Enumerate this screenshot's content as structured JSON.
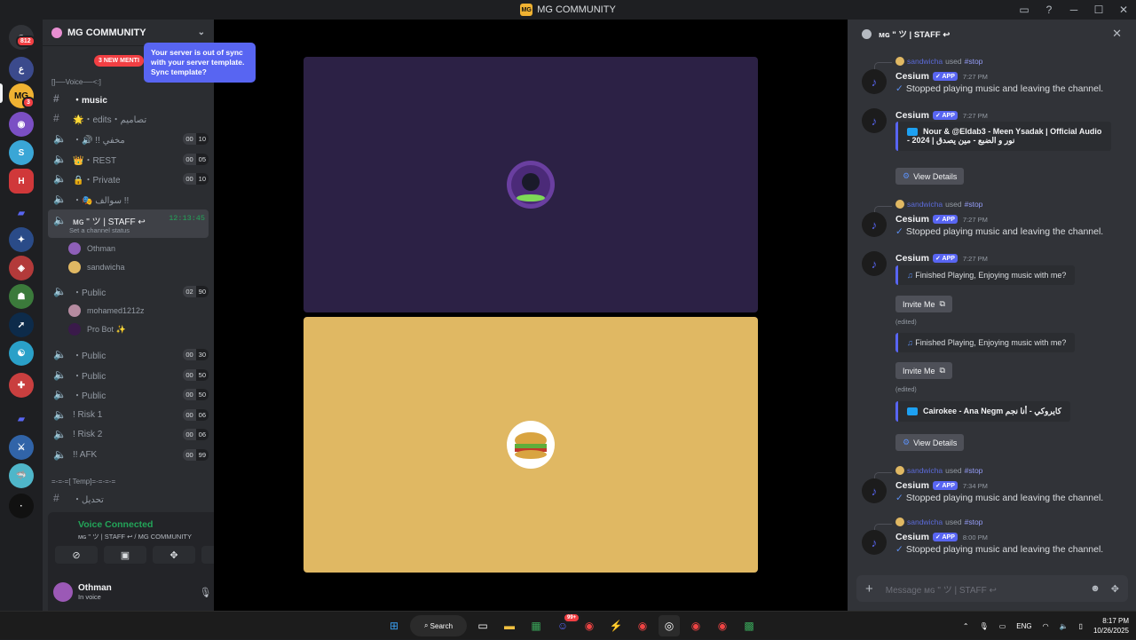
{
  "window": {
    "title": "MG COMMUNITY",
    "logo_text": "MG"
  },
  "rail": {
    "badge_top": "812",
    "badge_mg": "3"
  },
  "guild": {
    "name": "MG COMMUNITY",
    "tooltip": "Your server is out of sync with your server template. Sync template?",
    "new_mentions": "3 NEW MENTI"
  },
  "categories": {
    "voice": "[]──Voice──<:]",
    "temp": "=-=-=[ Temp]=-=-=-="
  },
  "channels": [
    {
      "name": "・music",
      "icon": "#",
      "counts": null
    },
    {
      "name": "🌟・edits・تصاميم",
      "icon": "#",
      "counts": null
    },
    {
      "name": "・🔊 !! مخفي",
      "icon": "🔊",
      "counts": [
        "00",
        "10"
      ]
    },
    {
      "name": "👑・REST",
      "icon": "🔊",
      "counts": [
        "00",
        "05"
      ]
    },
    {
      "name": "🔒・Private",
      "icon": "🔊",
      "counts": [
        "00",
        "10"
      ]
    },
    {
      "name": "・🎭 سوالف !!",
      "icon": "🔊",
      "counts": null
    }
  ],
  "active_channel": {
    "name": "ᴍɢ \" ツ | STAFF ↩",
    "time": "12:13:45",
    "status": "Set a channel status"
  },
  "members_staff": [
    "Othman",
    "sandwicha"
  ],
  "channels2": [
    {
      "name": "・Public",
      "counts": [
        "02",
        "90"
      ]
    }
  ],
  "members_public": [
    "mohamed1212z",
    "Pro Bot ✨"
  ],
  "channels3": [
    {
      "name": "・Public",
      "counts": [
        "00",
        "30"
      ]
    },
    {
      "name": "・Public",
      "counts": [
        "00",
        "50"
      ]
    },
    {
      "name": "・Public",
      "counts": [
        "00",
        "50"
      ]
    },
    {
      "name": "! Risk 1",
      "counts": [
        "00",
        "06"
      ]
    },
    {
      "name": "! Risk 2",
      "counts": [
        "00",
        "06"
      ]
    },
    {
      "name": "!! AFK",
      "counts": [
        "00",
        "99"
      ]
    }
  ],
  "temp_channel": "・تحديل",
  "voice": {
    "title": "Voice Connected",
    "subtitle": "ᴍɢ \" ツ | STAFF ↩ / MG COMMUNITY"
  },
  "user": {
    "name": "Othman",
    "status": "In voice"
  },
  "chat": {
    "header": "ᴍɢ \" ツ | STAFF ↩",
    "reply_user": "sandwicha",
    "reply_used": "used",
    "reply_cmd": "stop",
    "bot": "Cesium",
    "app_tag": "✓ APP",
    "stopped": "Stopped playing music and leaving the channel.",
    "song1": "Nour & @Eldab3 - Meen Ysadak | Official Audio - نور و الضبع - مين يصدق | 2024",
    "view_details": "View Details",
    "finished": "Finished Playing, Enjoying music with me?",
    "invite": "Invite Me",
    "edited": "(edited)",
    "song2": "Cairokee - Ana Negm كايروكي - أنا نجم",
    "times": [
      "7:27 PM",
      "7:27 PM",
      "7:27 PM",
      "7:27 PM",
      "7:34 PM",
      "8:00 PM"
    ],
    "composer_placeholder": "Message ᴍɢ \" ツ | STAFF ↩"
  },
  "taskbar": {
    "search": "Search",
    "lang": "ENG",
    "time": "8:17 PM",
    "date": "10/26/2025",
    "badge": "99+"
  }
}
